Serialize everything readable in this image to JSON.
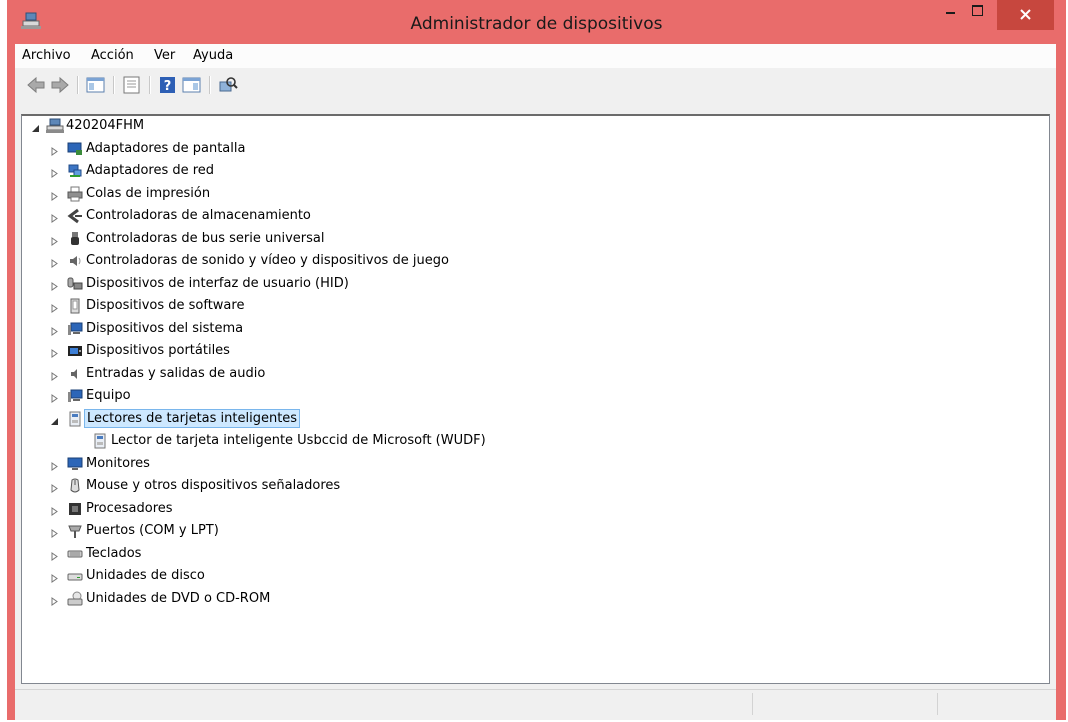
{
  "window": {
    "title": "Administrador de dispositivos",
    "titlebar_color": "#e96c6b",
    "close_color": "#c7473e"
  },
  "menu": {
    "items": [
      "Archivo",
      "Acción",
      "Ver",
      "Ayuda"
    ]
  },
  "toolbar": {
    "buttons": [
      "back-icon",
      "forward-icon",
      "console-tree-icon",
      "properties-icon",
      "help-icon",
      "action-pane-icon",
      "scan-hardware-icon"
    ]
  },
  "tree": {
    "root": "420204FHM",
    "categories": [
      {
        "label": "Adaptadores de pantalla",
        "icon": "display-adapter-icon"
      },
      {
        "label": "Adaptadores de red",
        "icon": "network-adapter-icon"
      },
      {
        "label": "Colas de impresión",
        "icon": "printer-icon"
      },
      {
        "label": "Controladoras de almacenamiento",
        "icon": "storage-controller-icon"
      },
      {
        "label": "Controladoras de bus serie universal",
        "icon": "usb-icon"
      },
      {
        "label": "Controladoras de sonido y vídeo y dispositivos de juego",
        "icon": "speaker-icon"
      },
      {
        "label": "Dispositivos de interfaz de usuario (HID)",
        "icon": "hid-icon"
      },
      {
        "label": "Dispositivos de software",
        "icon": "software-device-icon"
      },
      {
        "label": "Dispositivos del sistema",
        "icon": "system-device-icon"
      },
      {
        "label": "Dispositivos portátiles",
        "icon": "portable-device-icon"
      },
      {
        "label": "Entradas y salidas de audio",
        "icon": "audio-io-icon"
      },
      {
        "label": "Equipo",
        "icon": "computer-icon"
      },
      {
        "label": "Lectores de tarjetas inteligentes",
        "icon": "smart-card-reader-icon",
        "expanded": true,
        "selected": true,
        "children": [
          "Lector de tarjeta inteligente Usbccid de Microsoft (WUDF)"
        ]
      },
      {
        "label": "Monitores",
        "icon": "monitor-icon"
      },
      {
        "label": "Mouse y otros dispositivos señaladores",
        "icon": "mouse-icon"
      },
      {
        "label": "Procesadores",
        "icon": "processor-icon"
      },
      {
        "label": "Puertos (COM y LPT)",
        "icon": "port-icon"
      },
      {
        "label": "Teclados",
        "icon": "keyboard-icon"
      },
      {
        "label": "Unidades de disco",
        "icon": "disk-drive-icon"
      },
      {
        "label": "Unidades de DVD o CD-ROM",
        "icon": "dvd-drive-icon"
      }
    ]
  }
}
